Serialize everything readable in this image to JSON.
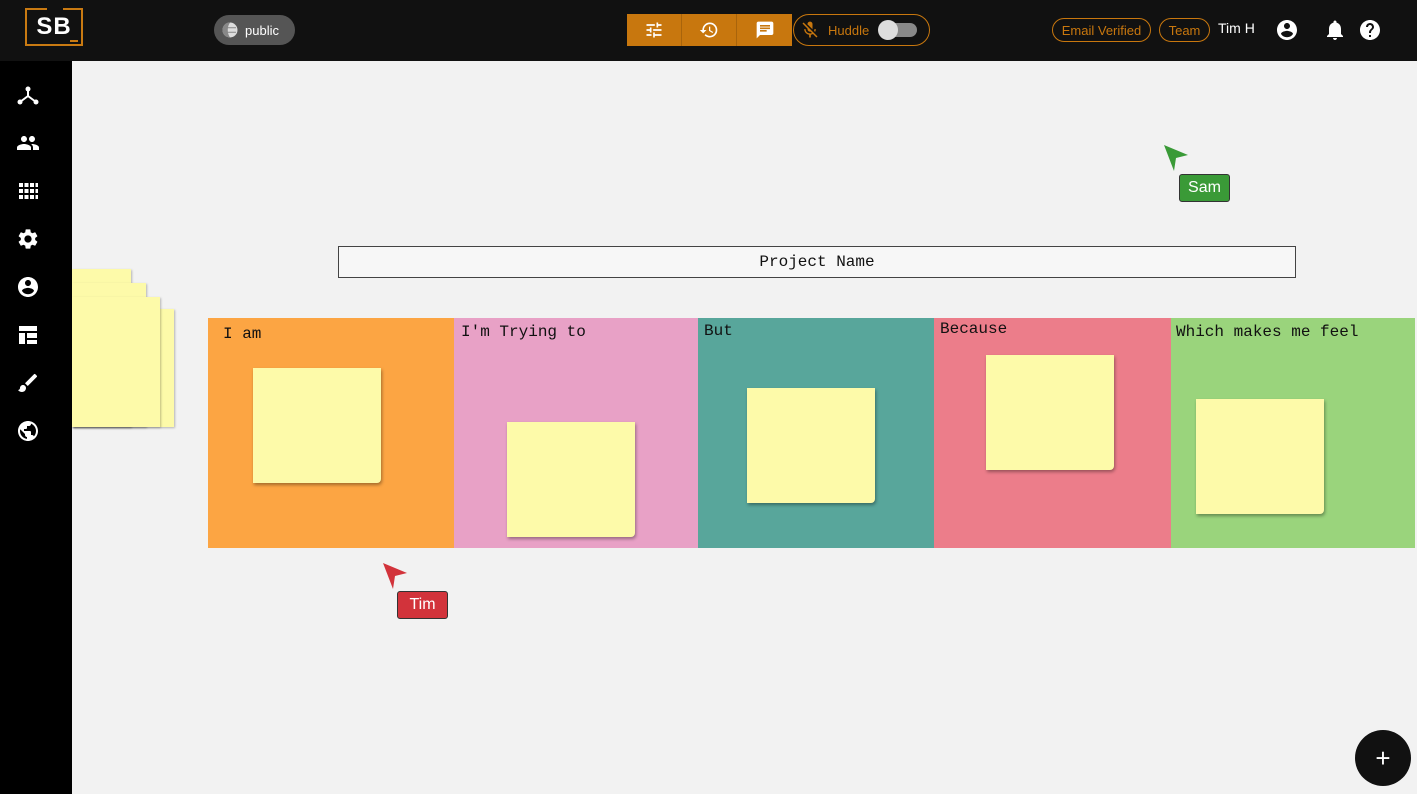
{
  "header": {
    "logo_text": "SB",
    "visibility_label": "public",
    "toolbar": {
      "buttons": [
        "tune-icon",
        "history-icon",
        "chat-icon"
      ]
    },
    "huddle": {
      "label": "Huddle",
      "enabled": false
    },
    "email_badge": "Email Verified",
    "team_badge": "Team",
    "user_name": "Tim H"
  },
  "sidebar": {
    "items": [
      "graph-icon",
      "people-icon",
      "apps-grid-icon",
      "settings-gear-icon",
      "account-circle-icon",
      "table-layout-icon",
      "brush-icon",
      "globe-icon"
    ]
  },
  "board": {
    "project_name": "Project Name",
    "columns": [
      {
        "label": "I am",
        "color": "#fca543"
      },
      {
        "label": "I'm Trying to",
        "color": "#e8a1c6"
      },
      {
        "label": "But",
        "color": "#58a69b"
      },
      {
        "label": "Because",
        "color": "#ec7d8a"
      },
      {
        "label": "Which makes me feel",
        "color": "#9ad47c"
      }
    ],
    "sticky_color": "#fdfaa9"
  },
  "collaborators": [
    {
      "name": "Sam",
      "color": "#3a9a37"
    },
    {
      "name": "Tim",
      "color": "#d2333b"
    }
  ],
  "fab_label": "+"
}
